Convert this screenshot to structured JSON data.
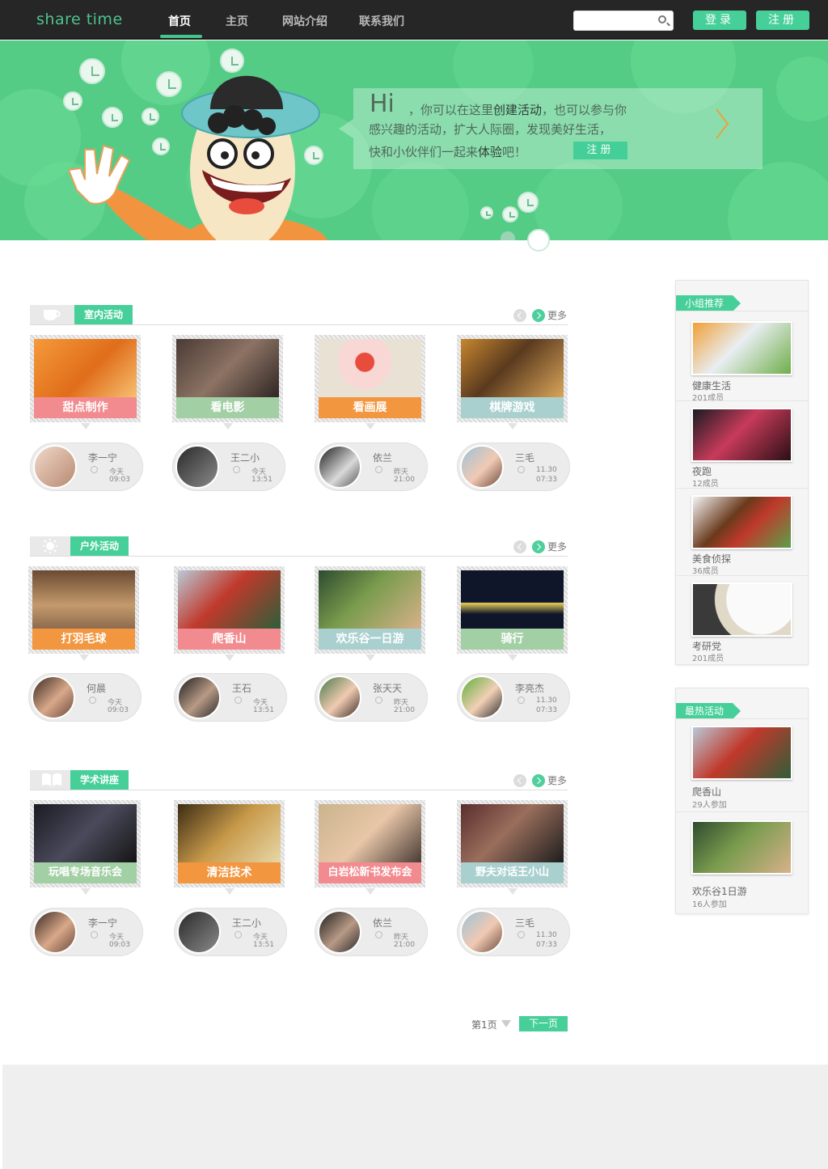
{
  "header": {
    "logo": "share time",
    "nav": [
      "首页",
      "主页",
      "网站介绍",
      "联系我们"
    ],
    "search_placeholder": "",
    "login": "登录",
    "register": "注册"
  },
  "hero": {
    "hi": "Hi",
    "line1_pre": "，你可以在这里",
    "line1_em": "创建活动",
    "line1_post": "，也可以参与你",
    "line2": "感兴趣的活动，扩大人际圈，发现美好生活，",
    "line3_pre": "快和小伙伴们一起来",
    "line3_em": "体验",
    "line3_post": "吧！",
    "register": "注册"
  },
  "sections": [
    {
      "title": "室内活动",
      "icon": "cup-icon",
      "more": "更多",
      "cards": [
        {
          "label": "甜点制作",
          "color": "#f28b8f"
        },
        {
          "label": "看电影",
          "color": "#a2cfa4"
        },
        {
          "label": "看画展",
          "color": "#f2963f"
        },
        {
          "label": "棋牌游戏",
          "color": "#a9d0cf"
        }
      ],
      "people": [
        {
          "name": "李一宁",
          "day": "今天",
          "time": "09:03"
        },
        {
          "name": "王二小",
          "day": "今天",
          "time": "13:51"
        },
        {
          "name": "依兰",
          "day": "昨天",
          "time": "21:00"
        },
        {
          "name": "三毛",
          "day": "11.30",
          "time": "07:33"
        }
      ]
    },
    {
      "title": "户外活动",
      "icon": "sun-icon",
      "more": "更多",
      "cards": [
        {
          "label": "打羽毛球",
          "color": "#f2963f"
        },
        {
          "label": "爬香山",
          "color": "#f28b8f"
        },
        {
          "label": "欢乐谷一日游",
          "color": "#a9d0cf"
        },
        {
          "label": "骑行",
          "color": "#a2cfa4"
        }
      ],
      "people": [
        {
          "name": "何晨",
          "day": "今天",
          "time": "09:03"
        },
        {
          "name": "王石",
          "day": "今天",
          "time": "13:51"
        },
        {
          "name": "张天天",
          "day": "昨天",
          "time": "21:00"
        },
        {
          "name": "李亮杰",
          "day": "11.30",
          "time": "07:33"
        }
      ]
    },
    {
      "title": "学术讲座",
      "icon": "book-icon",
      "more": "更多",
      "cards": [
        {
          "label": "玩唱专场音乐会",
          "color": "#a2cfa4"
        },
        {
          "label": "清洁技术",
          "color": "#f2963f"
        },
        {
          "label": "白岩松新书发布会",
          "color": "#f28b8f"
        },
        {
          "label": "野夫对话王小山",
          "color": "#a9d0cf"
        }
      ],
      "people": [
        {
          "name": "李一宁",
          "day": "今天",
          "time": "09:03"
        },
        {
          "name": "王二小",
          "day": "今天",
          "time": "13:51"
        },
        {
          "name": "依兰",
          "day": "昨天",
          "time": "21:00"
        },
        {
          "name": "三毛",
          "day": "11.30",
          "time": "07:33"
        }
      ]
    }
  ],
  "sidebar": {
    "groups": {
      "title": "小组推荐",
      "items": [
        {
          "name": "健康生活",
          "meta": "201成员"
        },
        {
          "name": "夜跑",
          "meta": "12成员"
        },
        {
          "name": "美食侦探",
          "meta": "36成员"
        },
        {
          "name": "考研党",
          "meta": "201成员"
        }
      ]
    },
    "hot": {
      "title": "最热活动",
      "items": [
        {
          "name": "爬香山",
          "meta": "29人参加"
        },
        {
          "name": "欢乐谷1日游",
          "meta": "16人参加"
        }
      ]
    }
  },
  "pagination": {
    "current": "第1页",
    "next": "下一页"
  }
}
